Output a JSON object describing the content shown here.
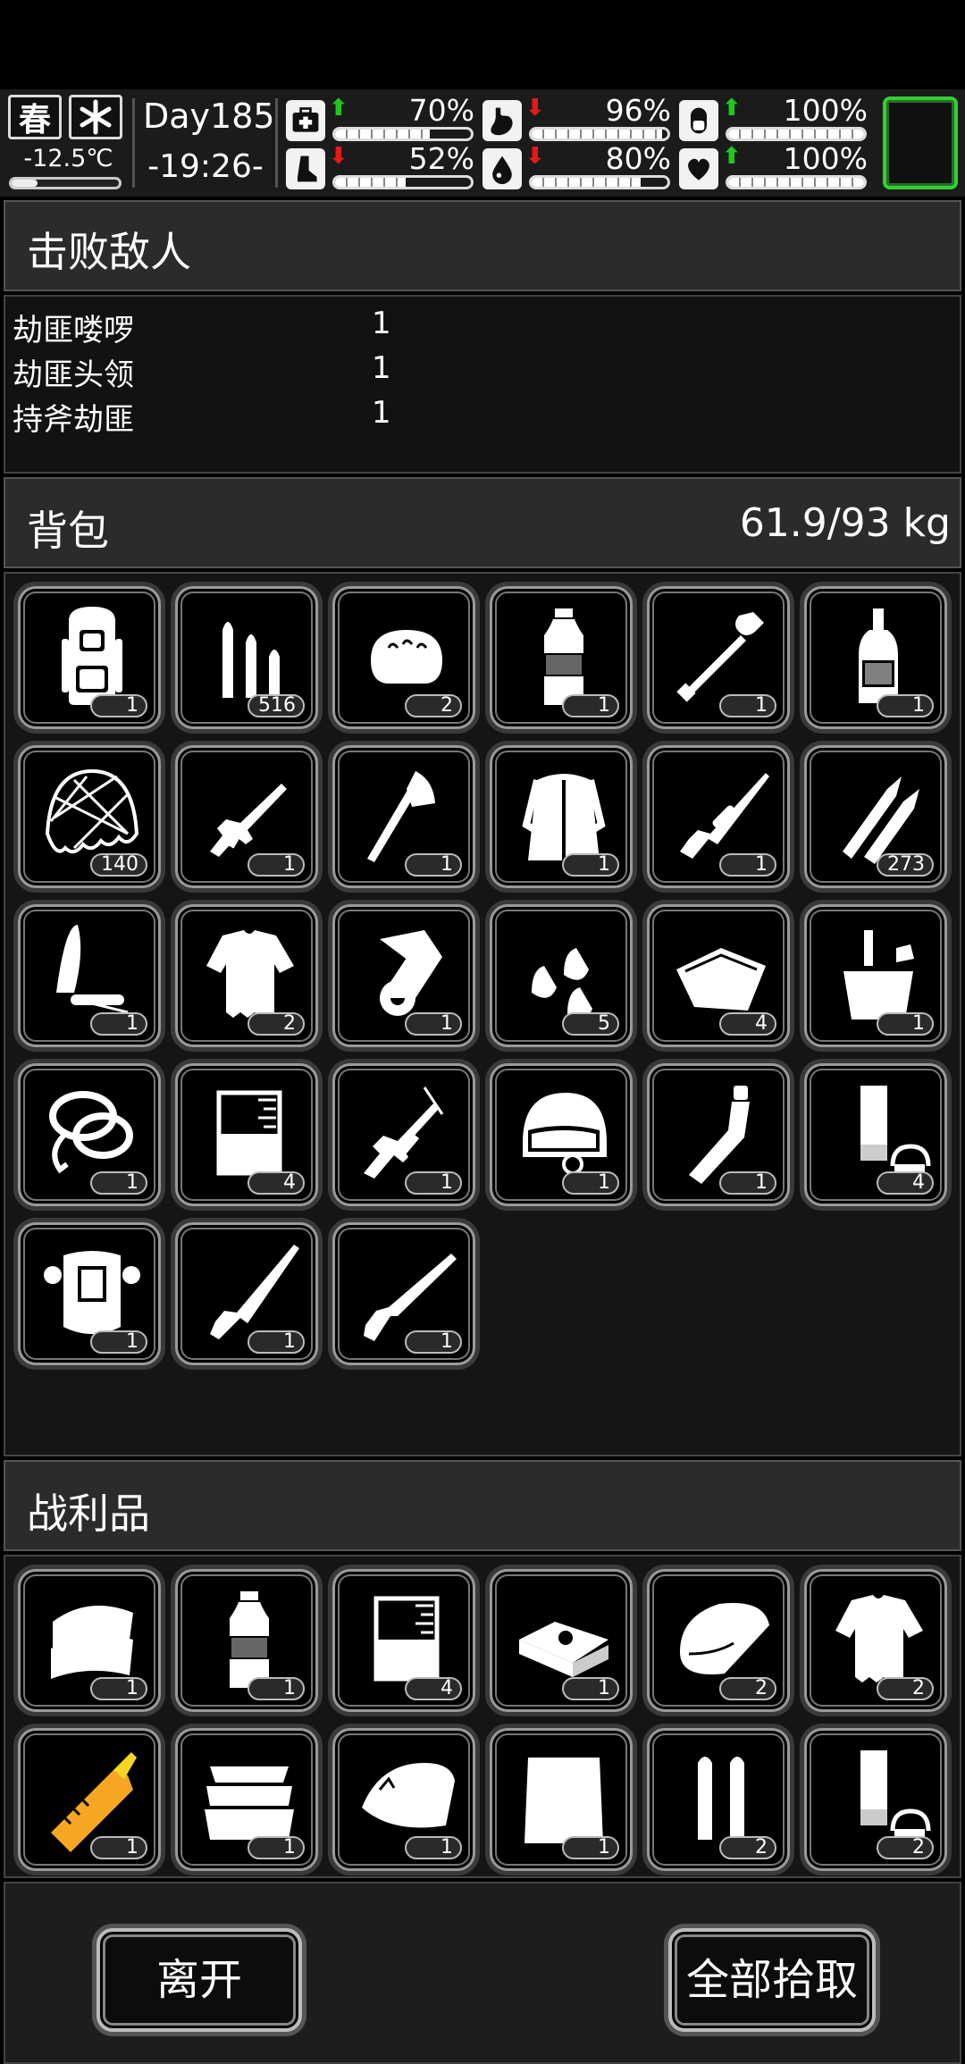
{
  "status": {
    "season": "春",
    "weather_icon": "snowflake-icon",
    "temperature": "-12.5℃",
    "temperature_level": 0.24,
    "day": "Day185",
    "time": "-19:26-",
    "stats": [
      {
        "name": "health",
        "icon": "medkit-icon",
        "trend": "up",
        "percent": "70%",
        "level": 0.7
      },
      {
        "name": "hunger",
        "icon": "stomach-icon",
        "trend": "down",
        "percent": "96%",
        "level": 0.96
      },
      {
        "name": "medicine",
        "icon": "pill-icon",
        "trend": "up",
        "percent": "100%",
        "level": 1.0
      },
      {
        "name": "stamina",
        "icon": "foot-icon",
        "trend": "down",
        "percent": "52%",
        "level": 0.52
      },
      {
        "name": "thirst",
        "icon": "water-drop-icon",
        "trend": "down",
        "percent": "80%",
        "level": 0.8
      },
      {
        "name": "mood",
        "icon": "heart-icon",
        "trend": "up",
        "percent": "100%",
        "level": 1.0
      }
    ],
    "arrow_up": "⬆",
    "arrow_down": "⬇"
  },
  "defeated": {
    "title": "击败敌人",
    "enemies": [
      {
        "name": "劫匪喽啰",
        "count": "1"
      },
      {
        "name": "劫匪头领",
        "count": "1"
      },
      {
        "name": "持斧劫匪",
        "count": "1"
      }
    ]
  },
  "backpack": {
    "title": "背包",
    "weight": "61.9/93 kg",
    "items": [
      {
        "icon": "backpack-icon",
        "qty": "1"
      },
      {
        "icon": "rifle-bullets-icon",
        "qty": "516"
      },
      {
        "icon": "bread-icon",
        "qty": "2"
      },
      {
        "icon": "water-bottle-icon",
        "qty": "1"
      },
      {
        "icon": "shovel-icon",
        "qty": "1"
      },
      {
        "icon": "liquor-bottle-icon",
        "qty": "1"
      },
      {
        "icon": "camo-net-icon",
        "qty": "140"
      },
      {
        "icon": "assault-rifle-icon",
        "qty": "1"
      },
      {
        "icon": "axe-icon",
        "qty": "1"
      },
      {
        "icon": "fur-coat-icon",
        "qty": "1"
      },
      {
        "icon": "sniper-rifle-icon",
        "qty": "1"
      },
      {
        "icon": "large-bullets-icon",
        "qty": "273"
      },
      {
        "icon": "knife-icon",
        "qty": "1"
      },
      {
        "icon": "ragged-shirt-icon",
        "qty": "2"
      },
      {
        "icon": "cloth-roll-icon",
        "qty": "1"
      },
      {
        "icon": "pistol-bullets-icon",
        "qty": "5"
      },
      {
        "icon": "bandage-icon",
        "qty": "4"
      },
      {
        "icon": "bucket-icon",
        "qty": "1"
      },
      {
        "icon": "rope-icon",
        "qty": "1"
      },
      {
        "icon": "beaker-icon",
        "qty": "4"
      },
      {
        "icon": "smg-icon",
        "qty": "1"
      },
      {
        "icon": "helmet-icon",
        "qty": "1"
      },
      {
        "icon": "flask-icon",
        "qty": "1"
      },
      {
        "icon": "shotgun-shells-icon",
        "qty": "4"
      },
      {
        "icon": "body-armor-icon",
        "qty": "1"
      },
      {
        "icon": "hunting-rifle-icon",
        "qty": "1"
      },
      {
        "icon": "shotgun-icon",
        "qty": "1"
      }
    ]
  },
  "loot": {
    "title": "战利品",
    "items": [
      {
        "icon": "folded-cloth-icon",
        "qty": "1"
      },
      {
        "icon": "water-bottle-icon",
        "qty": "1"
      },
      {
        "icon": "beaker-icon",
        "qty": "4"
      },
      {
        "icon": "cash-stack-icon",
        "qty": "1"
      },
      {
        "icon": "towel-icon",
        "qty": "2"
      },
      {
        "icon": "ragged-shirt-icon",
        "qty": "2"
      },
      {
        "icon": "rocket-ammo-icon",
        "qty": "1",
        "color": "#f5a623"
      },
      {
        "icon": "fabric-pile-icon",
        "qty": "1"
      },
      {
        "icon": "torn-cloth-icon",
        "qty": "1"
      },
      {
        "icon": "cloth-sheet-icon",
        "qty": "1"
      },
      {
        "icon": "twin-bullets-icon",
        "qty": "2"
      },
      {
        "icon": "shotgun-shells-icon",
        "qty": "2"
      }
    ]
  },
  "buttons": {
    "leave": "离开",
    "take_all": "全部拾取"
  }
}
